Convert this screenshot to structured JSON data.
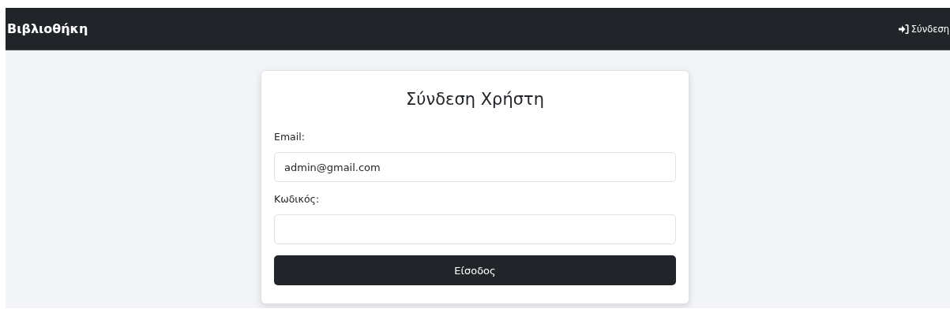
{
  "navbar": {
    "brand": "Βιβλιοθήκη",
    "login_link": "Σύνδεση"
  },
  "login_form": {
    "title": "Σύνδεση Χρήστη",
    "fields": [
      {
        "label": "Email:",
        "value": "admin@gmail.com"
      },
      {
        "label": "Κωδικός:"
      }
    ],
    "submit": "Είσοδος"
  }
}
